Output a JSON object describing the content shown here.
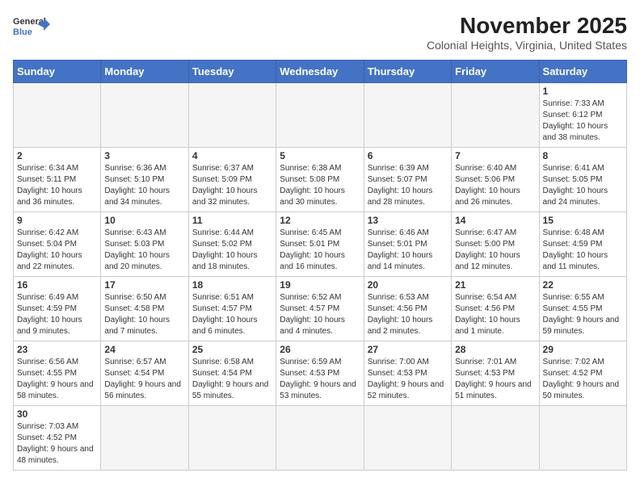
{
  "header": {
    "logo_text_general": "General",
    "logo_text_blue": "Blue",
    "month_year": "November 2025",
    "location": "Colonial Heights, Virginia, United States"
  },
  "days_of_week": [
    "Sunday",
    "Monday",
    "Tuesday",
    "Wednesday",
    "Thursday",
    "Friday",
    "Saturday"
  ],
  "weeks": [
    [
      {
        "day": null,
        "info": null
      },
      {
        "day": null,
        "info": null
      },
      {
        "day": null,
        "info": null
      },
      {
        "day": null,
        "info": null
      },
      {
        "day": null,
        "info": null
      },
      {
        "day": null,
        "info": null
      },
      {
        "day": "1",
        "info": "Sunrise: 7:33 AM\nSunset: 6:12 PM\nDaylight: 10 hours and 38 minutes."
      }
    ],
    [
      {
        "day": "2",
        "info": "Sunrise: 6:34 AM\nSunset: 5:11 PM\nDaylight: 10 hours and 36 minutes."
      },
      {
        "day": "3",
        "info": "Sunrise: 6:36 AM\nSunset: 5:10 PM\nDaylight: 10 hours and 34 minutes."
      },
      {
        "day": "4",
        "info": "Sunrise: 6:37 AM\nSunset: 5:09 PM\nDaylight: 10 hours and 32 minutes."
      },
      {
        "day": "5",
        "info": "Sunrise: 6:38 AM\nSunset: 5:08 PM\nDaylight: 10 hours and 30 minutes."
      },
      {
        "day": "6",
        "info": "Sunrise: 6:39 AM\nSunset: 5:07 PM\nDaylight: 10 hours and 28 minutes."
      },
      {
        "day": "7",
        "info": "Sunrise: 6:40 AM\nSunset: 5:06 PM\nDaylight: 10 hours and 26 minutes."
      },
      {
        "day": "8",
        "info": "Sunrise: 6:41 AM\nSunset: 5:05 PM\nDaylight: 10 hours and 24 minutes."
      }
    ],
    [
      {
        "day": "9",
        "info": "Sunrise: 6:42 AM\nSunset: 5:04 PM\nDaylight: 10 hours and 22 minutes."
      },
      {
        "day": "10",
        "info": "Sunrise: 6:43 AM\nSunset: 5:03 PM\nDaylight: 10 hours and 20 minutes."
      },
      {
        "day": "11",
        "info": "Sunrise: 6:44 AM\nSunset: 5:02 PM\nDaylight: 10 hours and 18 minutes."
      },
      {
        "day": "12",
        "info": "Sunrise: 6:45 AM\nSunset: 5:01 PM\nDaylight: 10 hours and 16 minutes."
      },
      {
        "day": "13",
        "info": "Sunrise: 6:46 AM\nSunset: 5:01 PM\nDaylight: 10 hours and 14 minutes."
      },
      {
        "day": "14",
        "info": "Sunrise: 6:47 AM\nSunset: 5:00 PM\nDaylight: 10 hours and 12 minutes."
      },
      {
        "day": "15",
        "info": "Sunrise: 6:48 AM\nSunset: 4:59 PM\nDaylight: 10 hours and 11 minutes."
      }
    ],
    [
      {
        "day": "16",
        "info": "Sunrise: 6:49 AM\nSunset: 4:59 PM\nDaylight: 10 hours and 9 minutes."
      },
      {
        "day": "17",
        "info": "Sunrise: 6:50 AM\nSunset: 4:58 PM\nDaylight: 10 hours and 7 minutes."
      },
      {
        "day": "18",
        "info": "Sunrise: 6:51 AM\nSunset: 4:57 PM\nDaylight: 10 hours and 6 minutes."
      },
      {
        "day": "19",
        "info": "Sunrise: 6:52 AM\nSunset: 4:57 PM\nDaylight: 10 hours and 4 minutes."
      },
      {
        "day": "20",
        "info": "Sunrise: 6:53 AM\nSunset: 4:56 PM\nDaylight: 10 hours and 2 minutes."
      },
      {
        "day": "21",
        "info": "Sunrise: 6:54 AM\nSunset: 4:56 PM\nDaylight: 10 hours and 1 minute."
      },
      {
        "day": "22",
        "info": "Sunrise: 6:55 AM\nSunset: 4:55 PM\nDaylight: 9 hours and 59 minutes."
      }
    ],
    [
      {
        "day": "23",
        "info": "Sunrise: 6:56 AM\nSunset: 4:55 PM\nDaylight: 9 hours and 58 minutes."
      },
      {
        "day": "24",
        "info": "Sunrise: 6:57 AM\nSunset: 4:54 PM\nDaylight: 9 hours and 56 minutes."
      },
      {
        "day": "25",
        "info": "Sunrise: 6:58 AM\nSunset: 4:54 PM\nDaylight: 9 hours and 55 minutes."
      },
      {
        "day": "26",
        "info": "Sunrise: 6:59 AM\nSunset: 4:53 PM\nDaylight: 9 hours and 53 minutes."
      },
      {
        "day": "27",
        "info": "Sunrise: 7:00 AM\nSunset: 4:53 PM\nDaylight: 9 hours and 52 minutes."
      },
      {
        "day": "28",
        "info": "Sunrise: 7:01 AM\nSunset: 4:53 PM\nDaylight: 9 hours and 51 minutes."
      },
      {
        "day": "29",
        "info": "Sunrise: 7:02 AM\nSunset: 4:52 PM\nDaylight: 9 hours and 50 minutes."
      }
    ],
    [
      {
        "day": "30",
        "info": "Sunrise: 7:03 AM\nSunset: 4:52 PM\nDaylight: 9 hours and 48 minutes."
      },
      {
        "day": null,
        "info": null
      },
      {
        "day": null,
        "info": null
      },
      {
        "day": null,
        "info": null
      },
      {
        "day": null,
        "info": null
      },
      {
        "day": null,
        "info": null
      },
      {
        "day": null,
        "info": null
      }
    ]
  ]
}
